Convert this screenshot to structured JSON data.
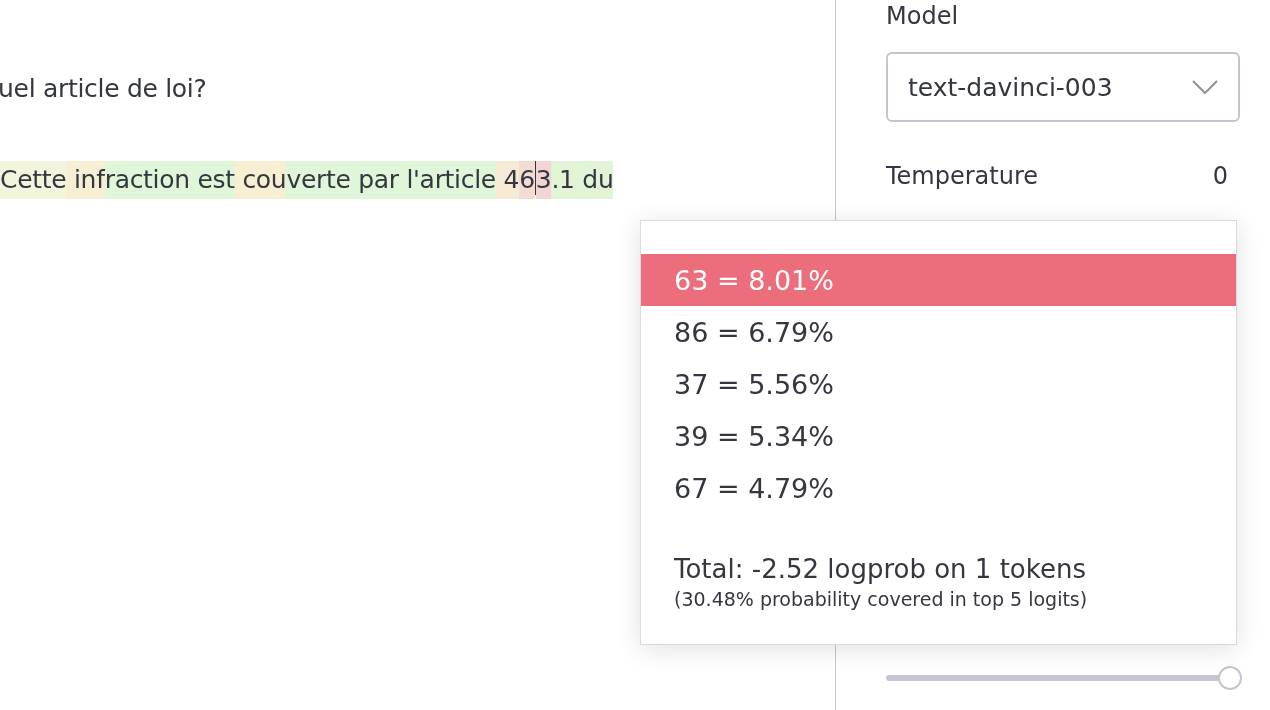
{
  "prompt": {
    "question": "uel article de loi?",
    "tokens": [
      {
        "text": "Cette",
        "color": "#f3f4dc"
      },
      {
        "text": " inf",
        "color": "#f7efd4"
      },
      {
        "text": "raction est",
        "color": "#dff7d8"
      },
      {
        "text": " cou",
        "color": "#f6efd2"
      },
      {
        "text": "verte par l'article",
        "color": "#dff7d8"
      },
      {
        "text": " 4",
        "color": "#f6ead4"
      },
      {
        "text": "6",
        "color": "#f4dcd2",
        "caret_after": true
      },
      {
        "text": "3",
        "color": "#f2d4d4",
        "caret_after": false
      },
      {
        "text": ".1 du",
        "color": "#e2f4d6"
      }
    ]
  },
  "popup": {
    "options": [
      {
        "text": "63 = 8.01%",
        "selected": true
      },
      {
        "text": "86 = 6.79%",
        "selected": false
      },
      {
        "text": "37 = 5.56%",
        "selected": false
      },
      {
        "text": "39 = 5.34%",
        "selected": false
      },
      {
        "text": "67 = 4.79%",
        "selected": false
      }
    ],
    "total": "Total: -2.52 logprob on 1 tokens",
    "coverage": "(30.48% probability covered in top 5 logits)"
  },
  "settings": {
    "model_label": "Model",
    "model_value": "text-davinci-003",
    "temperature_label": "Temperature",
    "temperature_value": "0",
    "bottom_slider": {
      "level": 1
    }
  }
}
